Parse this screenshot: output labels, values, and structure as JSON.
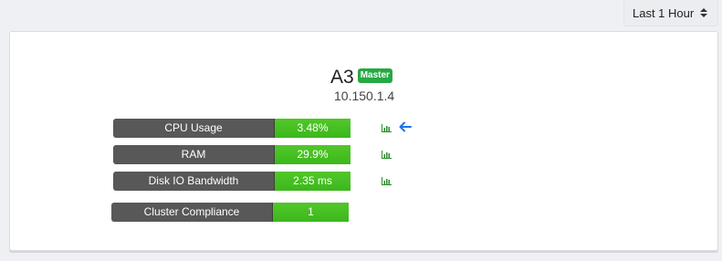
{
  "time_range": {
    "selected": "Last 1 Hour"
  },
  "node": {
    "name": "A3",
    "badge": "Master",
    "ip": "10.150.1.4"
  },
  "metrics": [
    {
      "label": "CPU Usage",
      "value": "3.48%"
    },
    {
      "label": "RAM",
      "value": "29.9%"
    },
    {
      "label": "Disk IO Bandwidth",
      "value": "2.35 ms"
    },
    {
      "label": "Cluster Compliance",
      "value": "1"
    }
  ],
  "colors": {
    "accent_green": "#3bb81b",
    "badge_green": "#27a844",
    "label_gray": "#585858",
    "arrow_blue": "#1a73e8"
  },
  "icons": {
    "chart": "bar-chart-icon",
    "arrow": "arrow-left-icon"
  }
}
